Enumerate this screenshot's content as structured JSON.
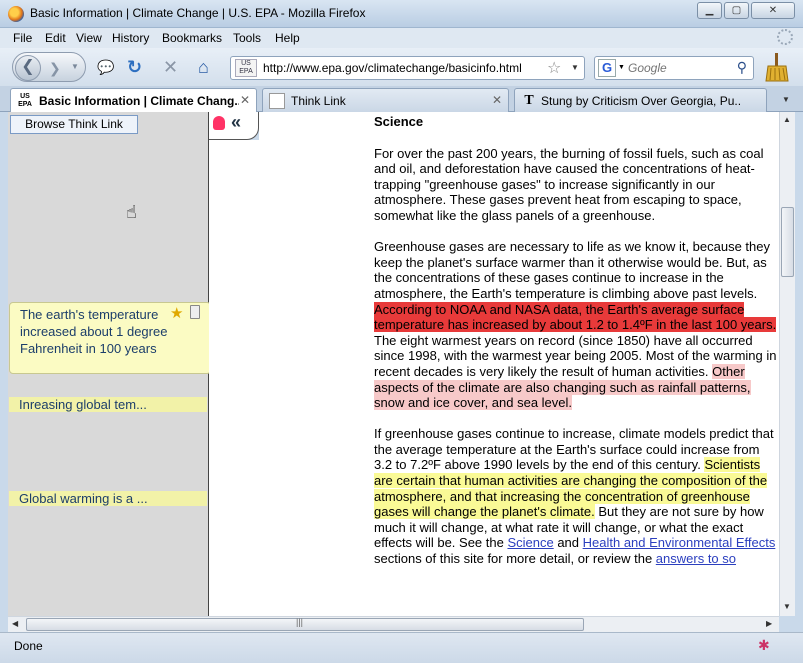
{
  "window": {
    "title": "Basic Information | Climate Change | U.S. EPA - Mozilla Firefox"
  },
  "menu": [
    "File",
    "Edit",
    "View",
    "History",
    "Bookmarks",
    "Tools",
    "Help"
  ],
  "navbar": {
    "url": "http://www.epa.gov/climatechange/basicinfo.html",
    "site_badge": "US EPA",
    "search_engine": "G",
    "search_placeholder": "Google"
  },
  "tabs": [
    {
      "label": "Basic Information | Climate Chang...",
      "favicon": "US EPA",
      "active": true
    },
    {
      "label": "Think Link",
      "active": false
    },
    {
      "label": "Stung by Criticism Over Georgia, Pu...",
      "favicon": "T",
      "active": false
    }
  ],
  "sidebar": {
    "browse_button": "Browse Think Link",
    "notes": [
      {
        "text": "The earth's temperature increased about 1 degree Fahrenheit in 100 years",
        "expanded": true
      },
      {
        "text": "Inreasing global tem...",
        "expanded": false
      },
      {
        "text": "Global warming is a ...",
        "expanded": false
      }
    ]
  },
  "article": {
    "heading": "Science",
    "p1": "For over the past 200 years, the burning of fossil fuels, such as coal and oil, and deforestation have caused the concentrations of heat-trapping \"greenhouse gases\" to increase significantly in our atmosphere. These gases prevent heat from escaping to space, somewhat like the glass panels of a greenhouse.",
    "p2a": "Greenhouse gases are necessary to life as we know it, because they keep the planet's surface warmer than it otherwise would be. But, as the concentrations of these gases continue to increase in the atmosphere, the Earth's temperature is climbing above past levels. ",
    "p2_hl_red": "According to NOAA and NASA data, the Earth's average surface temperature has increased by about 1.2 to 1.4ºF in the last 100 years.",
    "p2b": " The eight warmest years on record (since 1850) have all occurred since 1998, with the warmest year being 2005. Most of the warming in recent decades is very likely the result of human activities. ",
    "p2_hl_pink": "Other aspects of the climate are also changing such as rainfall patterns, snow and ice cover, and sea level.",
    "p3a": "If greenhouse gases continue to increase, climate models predict that the average temperature at the Earth's surface could increase from 3.2 to 7.2ºF above 1990 levels by the end of this century. ",
    "p3_hl_yellow": "Scientists are certain that human activities are changing the composition of the atmosphere, and that increasing the concentration of greenhouse gases will change the planet's climate.",
    "p3b": " But they are not sure by how much it will change, at what rate it will change, or what the exact effects will be. See the ",
    "link_science": "Science",
    "p3c": " and ",
    "link_health": "Health and Environmental Effects",
    "p3d": " sections of this site for more detail, or review the ",
    "link_answers": "answers to so"
  },
  "status": {
    "text": "Done"
  },
  "colors": {
    "highlight_red": "#e83a3a",
    "highlight_pink": "#f7c9c9",
    "highlight_yellow": "#fafa96",
    "note_bg": "#fbfbc3",
    "note_strip_bg": "#f2f2a8",
    "note_text": "#1c3e6a"
  }
}
